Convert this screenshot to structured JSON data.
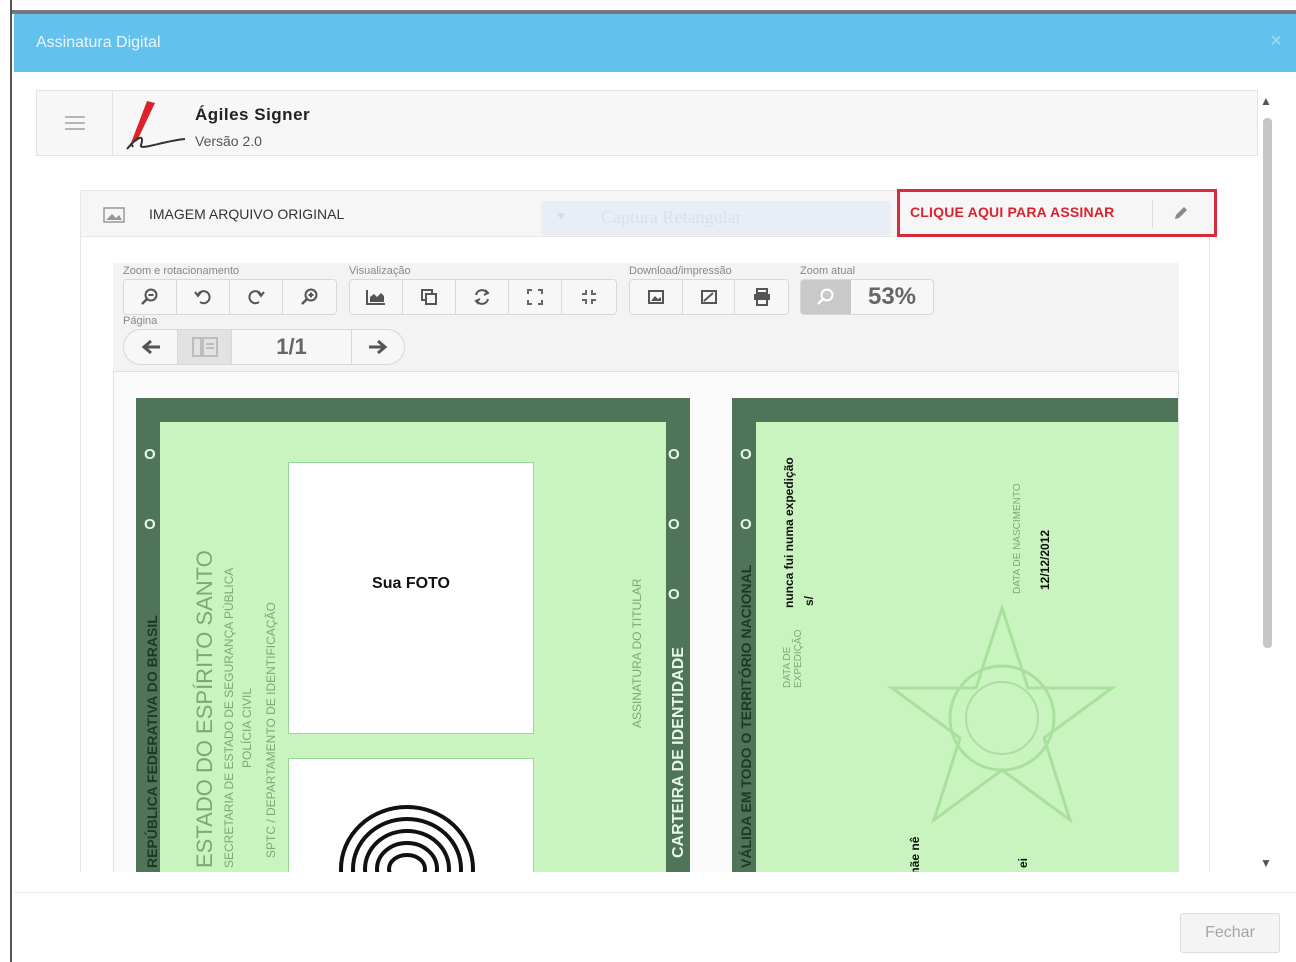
{
  "modal": {
    "title": "Assinatura Digital",
    "close_glyph": "×",
    "footer_button": "Fechar"
  },
  "app": {
    "name": "Ágiles Signer",
    "version": "Versão 2.0",
    "logo_icon": "pen-signature-logo"
  },
  "panel": {
    "title": "IMAGEM ARQUIVO ORIGINAL",
    "ghost_select_label": "Captura Retangular",
    "sign_button": "CLIQUE AQUI PARA ASSINAR",
    "sign_color": "#d9232f"
  },
  "toolbar": {
    "groups": {
      "zoom_rotate": "Zoom e rotacionamento",
      "view": "Visualização",
      "download": "Download/impressão",
      "zoom_current": "Zoom atual",
      "page": "Página"
    },
    "zoom_value": "53%",
    "page_value": "1/1"
  },
  "document": {
    "front": {
      "holes": [
        "O",
        "O",
        "O",
        "O",
        "O"
      ],
      "country": "REPÚBLICA FEDERATIVA DO BRASIL",
      "state": "ESTADO DO ESPÍRITO SANTO",
      "secretariat": "SECRETARIA DE ESTADO DE SEGURANÇA PÚBLICA",
      "police": "POLÍCIA CIVIL",
      "department": "SPTC / DEPARTAMENTO DE IDENTIFICAÇÃO",
      "photo_label": "Sua FOTO",
      "signature_label": "ASSINATURA DO TITULAR",
      "card_title": "CARTEIRA DE IDENTIDADE"
    },
    "back": {
      "validity": "VÁLIDA EM TODO O TERRITÓRIO NACIONAL",
      "expedition_place": "nunca fui numa expedição",
      "expedition_value": "s/",
      "expedition_label": "DATA DE EXPEDIÇÃO",
      "birth_label": "DATA DE NASCIMENTO",
      "birth_value": "12/12/2012",
      "mother": "a mãe nê",
      "father": "ei"
    }
  },
  "colors": {
    "header": "#63c1ee",
    "card_green": "#c9f4bf",
    "card_border": "#4f7457"
  }
}
